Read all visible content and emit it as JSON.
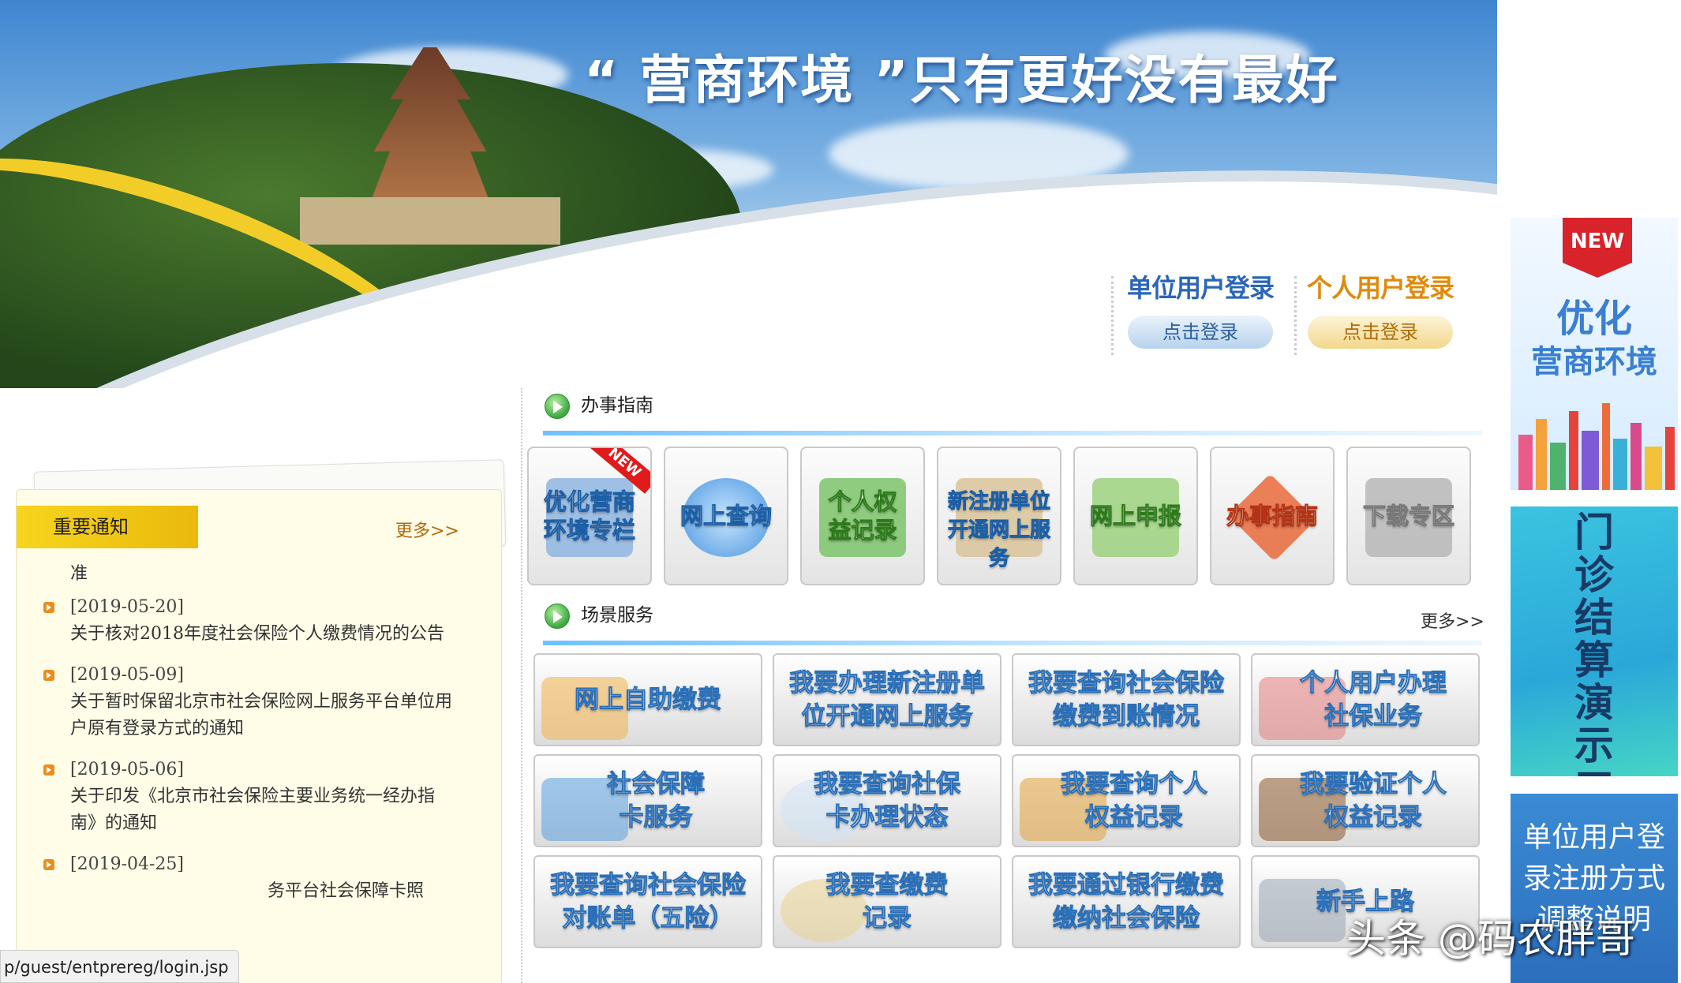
{
  "banner": {
    "slogan": "“ 营商环境 ”只有更好没有最好",
    "unit_login": {
      "title": "单位用户登录",
      "button": "点击登录"
    },
    "person_login": {
      "title": "个人用户登录",
      "button": "点击登录"
    }
  },
  "notices": {
    "header": "重要通知",
    "more": "更多>>",
    "partial_line": "准",
    "items": [
      {
        "date": "[2019-05-20]",
        "title": "关于核对2018年度社会保险个人缴费情况的公告"
      },
      {
        "date": "[2019-05-09]",
        "title": "关于暂时保留北京市社会保险网上服务平台单位用户原有登录方式的通知"
      },
      {
        "date": "[2019-05-06]",
        "title": "关于印发《北京市社会保险主要业务统一经办指南》的通知"
      },
      {
        "date": "[2019-04-25]",
        "title": "务平台社会保障卡照"
      }
    ]
  },
  "status_url": "p/guest/entprereg/login.jsp",
  "guide": {
    "title": "办事指南",
    "tiles": [
      {
        "label": "优化营商环境专栏",
        "badge": "NEW"
      },
      {
        "label": "网上查询"
      },
      {
        "label": "个人权益记录"
      },
      {
        "label": "新注册单位开通网上服务"
      },
      {
        "label": "网上申报"
      },
      {
        "label": "办事指南"
      },
      {
        "label": "下载专区"
      }
    ]
  },
  "scene": {
    "title": "场景服务",
    "more": "更多>>",
    "items": [
      "网上自助缴费",
      "我要办理新注册单位开通网上服务",
      "我要查询社会保险缴费到账情况",
      "个人用户办理社保业务",
      "社会保障卡服务",
      "我要查询社保卡办理状态",
      "我要查询个人权益记录",
      "我要验证个人权益记录",
      "我要查询社会保险对账单（五险）",
      "我要查缴费记录",
      "我要通过银行缴费缴纳社会保险",
      "新手上路"
    ]
  },
  "ads": {
    "ad1": {
      "badge": "NEW",
      "line1": "优化",
      "line2": "营商环境"
    },
    "ad2": {
      "text": "门诊结算演示工具"
    },
    "ad3": {
      "text": "单位用户登录注册方式调整说明"
    }
  },
  "watermark": "头条 @码农胖哥"
}
